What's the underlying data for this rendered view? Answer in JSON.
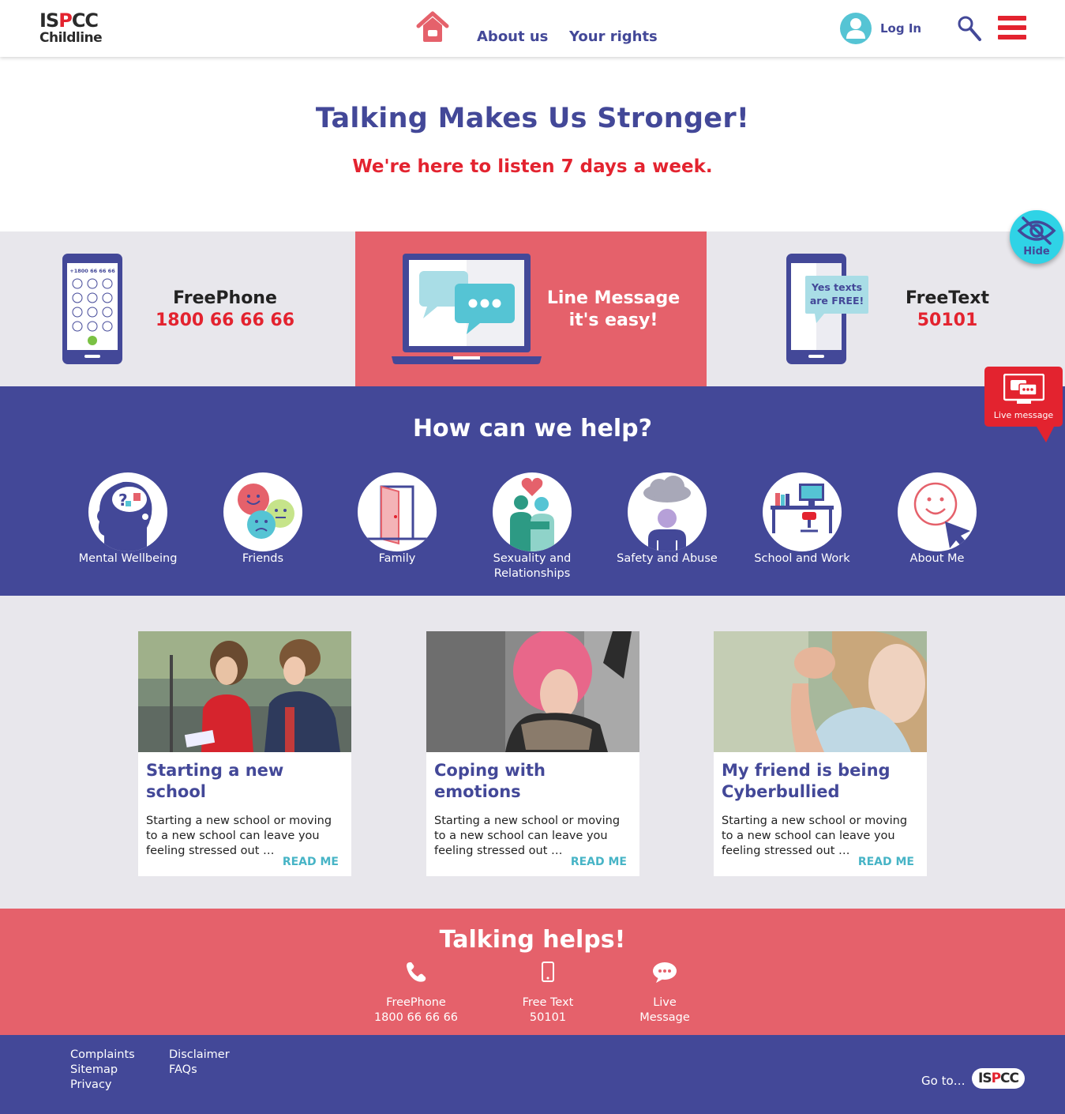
{
  "header": {
    "logo_top": "ISPCC",
    "logo_bottom": "Childline",
    "nav": [
      "About us",
      "Your rights"
    ],
    "login": "Log In"
  },
  "hero": {
    "title": "Talking Makes Us Stronger!",
    "subtitle": "We're here to listen 7 days a week."
  },
  "contact": {
    "phone_screen_number": "+1800 66 66 66",
    "freephone_label": "FreePhone",
    "freephone_number": "1800 66 66 66",
    "line_message_1": "Line Message",
    "line_message_2": "it's easy!",
    "bubble_1": "Yes texts",
    "bubble_2": "are FREE!",
    "freetext_label": "FreeText",
    "freetext_number": "50101"
  },
  "widgets": {
    "hide": "Hide",
    "live_message": "Live message"
  },
  "help": {
    "title": "How can we help?",
    "topics": [
      {
        "line1": "Mental Wellbeing",
        "line2": ""
      },
      {
        "line1": "Friends",
        "line2": ""
      },
      {
        "line1": "Family",
        "line2": ""
      },
      {
        "line1": "Sexuality and",
        "line2": "Relationships"
      },
      {
        "line1": "Safety and Abuse",
        "line2": ""
      },
      {
        "line1": "School and Work",
        "line2": ""
      },
      {
        "line1": "About Me",
        "line2": ""
      }
    ]
  },
  "articles": [
    {
      "title": "Starting a new school",
      "excerpt": "Starting a new school or moving to a new school can leave you feeling stressed out …",
      "more": "READ ME"
    },
    {
      "title": "Coping with emotions",
      "excerpt": "Starting a new school or moving to a new school can leave you feeling stressed out …",
      "more": "READ ME"
    },
    {
      "title": "My friend is being Cyberbullied",
      "excerpt": "Starting a new school or moving to a new school can leave you feeling stressed out …",
      "more": "READ ME"
    }
  ],
  "talking": {
    "title": "Talking helps!",
    "items": [
      {
        "line1": "FreePhone",
        "line2": "1800 66 66 66"
      },
      {
        "line1": "Free Text",
        "line2": "50101"
      },
      {
        "line1": "Live",
        "line2": "Message"
      }
    ]
  },
  "footer": {
    "col1": [
      "Complaints",
      "Sitemap",
      "Privacy"
    ],
    "col2": [
      "Disclaimer",
      "FAQs"
    ],
    "goto": "Go to…",
    "goto_logo": "ISPCC"
  },
  "colors": {
    "brand_purple": "#434898",
    "brand_red": "#e3232f",
    "coral": "#e5616b",
    "light_grey": "#e8e7ec",
    "teal": "#47b4c6",
    "cyan": "#2fd3e6"
  },
  "icons": [
    "home-icon",
    "user-icon",
    "search-icon",
    "menu-icon",
    "hide-eye-icon",
    "live-message-icon",
    "phone-icon",
    "mobile-icon",
    "chat-icon"
  ]
}
